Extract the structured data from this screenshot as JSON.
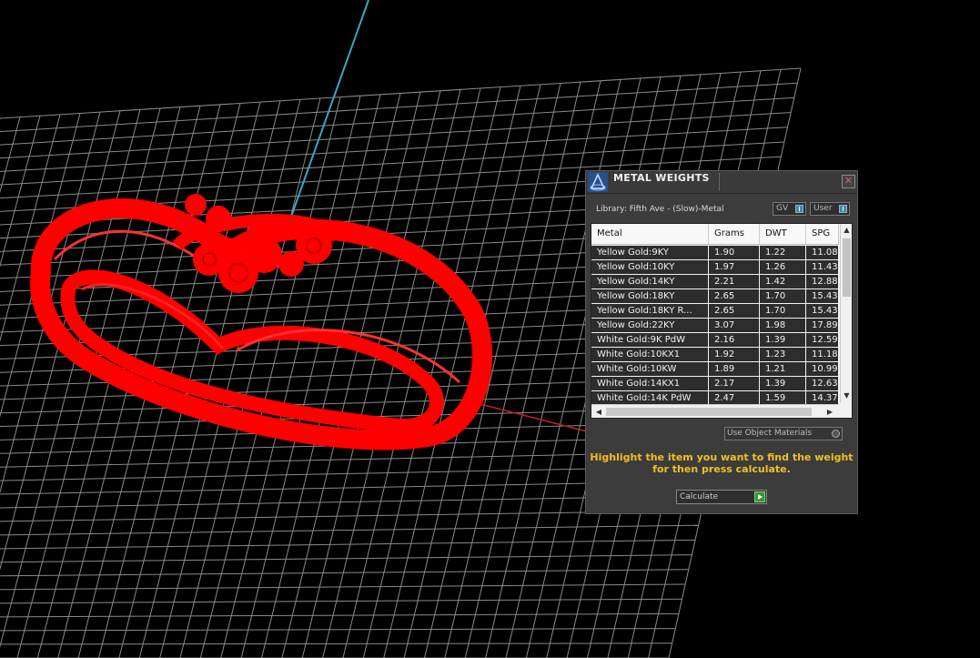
{
  "panel": {
    "title": "METAL WEIGHTS",
    "close_glyph": "✕",
    "library_label": "Library: Fifth Ave - (Slow)-Metal",
    "toggle_gv": "GV",
    "toggle_user": "User",
    "columns": [
      "Metal",
      "Grams",
      "DWT",
      "SPG"
    ],
    "rows": [
      [
        "Yellow Gold:9KY",
        "1.90",
        "1.22",
        "11.08"
      ],
      [
        "Yellow Gold:10KY",
        "1.97",
        "1.26",
        "11.43"
      ],
      [
        "Yellow Gold:14KY",
        "2.21",
        "1.42",
        "12.88"
      ],
      [
        "Yellow Gold:18KY",
        "2.65",
        "1.70",
        "15.43"
      ],
      [
        "Yellow Gold:18KY R...",
        "2.65",
        "1.70",
        "15.43"
      ],
      [
        "Yellow Gold:22KY",
        "3.07",
        "1.98",
        "17.89"
      ],
      [
        "White Gold:9K PdW",
        "2.16",
        "1.39",
        "12.59"
      ],
      [
        "White Gold:10KX1",
        "1.92",
        "1.23",
        "11.18"
      ],
      [
        "White Gold:10KW",
        "1.89",
        "1.21",
        "10.99"
      ],
      [
        "White Gold:14KX1",
        "2.17",
        "1.39",
        "12.63"
      ],
      [
        "White Gold:14K PdW",
        "2.47",
        "1.59",
        "14.37"
      ]
    ],
    "use_object_materials": "Use Object Materials",
    "instruction_line1": "Highlight the item you want to find the weight",
    "instruction_line2": "for then press calculate.",
    "calculate_label": "Calculate"
  },
  "icons": {
    "logo": "app-logo-icon",
    "close": "close-icon",
    "scroll_up": "scroll-up-icon",
    "scroll_down": "scroll-down-icon",
    "scroll_left": "scroll-left-icon",
    "scroll_right": "scroll-right-icon",
    "calculate": "play-icon"
  },
  "colors": {
    "viewport_bg": "#000000",
    "grid": "#8a8a8a",
    "axis_y": "#3aa6c8",
    "axis_x": "#c02020",
    "model": "#ff0000",
    "panel_bg": "#3c3c3c",
    "instruction": "#f0c020"
  }
}
